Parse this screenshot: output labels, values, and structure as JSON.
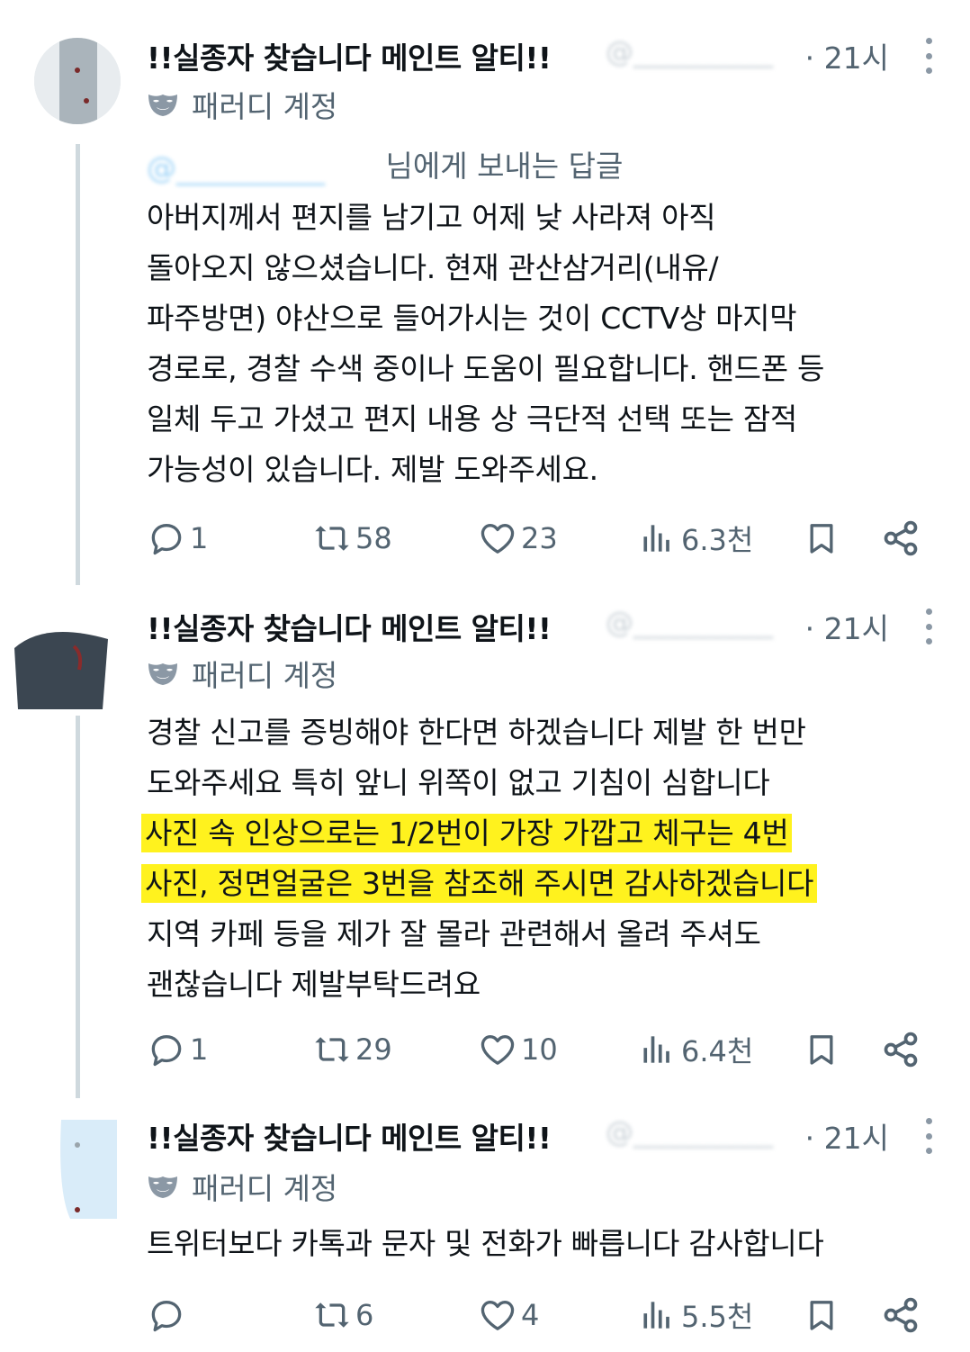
{
  "tweets": [
    {
      "name": "!!실종자 찾습니다 메인트 알티!!",
      "handle": "@__________",
      "time": "· 21시",
      "label": "패러디 계정",
      "reply_handle": "@__________",
      "reply_suffix": "님에게 보내는 답글",
      "text": "아버지께서 편지를 남기고 어제 낮 사라져 아직\n돌아오지 않으셨습니다. 현재 관산삼거리(내유/\n파주방면) 야산으로 들어가시는 것이 CCTV상 마지막\n경로로, 경찰 수색 중이나 도움이 필요합니다. 핸드폰 등\n일체 두고 가셨고 편지 내용 상 극단적 선택 또는 잠적\n가능성이 있습니다. 제발 도와주세요.",
      "replies": "1",
      "retweets": "58",
      "likes": "23",
      "views": "6.3천"
    },
    {
      "name": "!!실종자 찾습니다 메인트 알티!!",
      "handle": "@__________",
      "time": "· 21시",
      "label": "패러디 계정",
      "text_before": "경찰 신고를 증빙해야 한다면 하겠습니다 제발 한 번만\n도와주세요 특히 앞니 위쪽이 없고 기침이 심합니다\n",
      "text_highlight": "사진 속 인상으로는 1/2번이 가장 가깝고 체구는 4번\n사진, 정면얼굴은 3번을 참조해 주시면 감사하겠습니다",
      "text_after": "\n지역 카페 등을 제가 잘 몰라 관련해서 올려 주셔도\n괜찮습니다 제발부탁드려요",
      "replies": "1",
      "retweets": "29",
      "likes": "10",
      "views": "6.4천"
    },
    {
      "name": "!!실종자 찾습니다 메인트 알티!!",
      "handle": "@__________",
      "time": "· 21시",
      "label": "패러디 계정",
      "text": "트위터보다 카톡과 문자 및 전화가 빠릅니다 감사합니다",
      "replies": "",
      "retweets": "6",
      "likes": "4",
      "views": "5.5천"
    }
  ],
  "colors": {
    "text": "#0f1419",
    "secondary": "#536471",
    "highlight": "#fff21e",
    "thread_line": "#cfd9de"
  },
  "icons": [
    "reply-icon",
    "retweet-icon",
    "like-icon",
    "views-icon",
    "bookmark-icon",
    "share-icon",
    "parody-mask-icon",
    "more-icon"
  ]
}
